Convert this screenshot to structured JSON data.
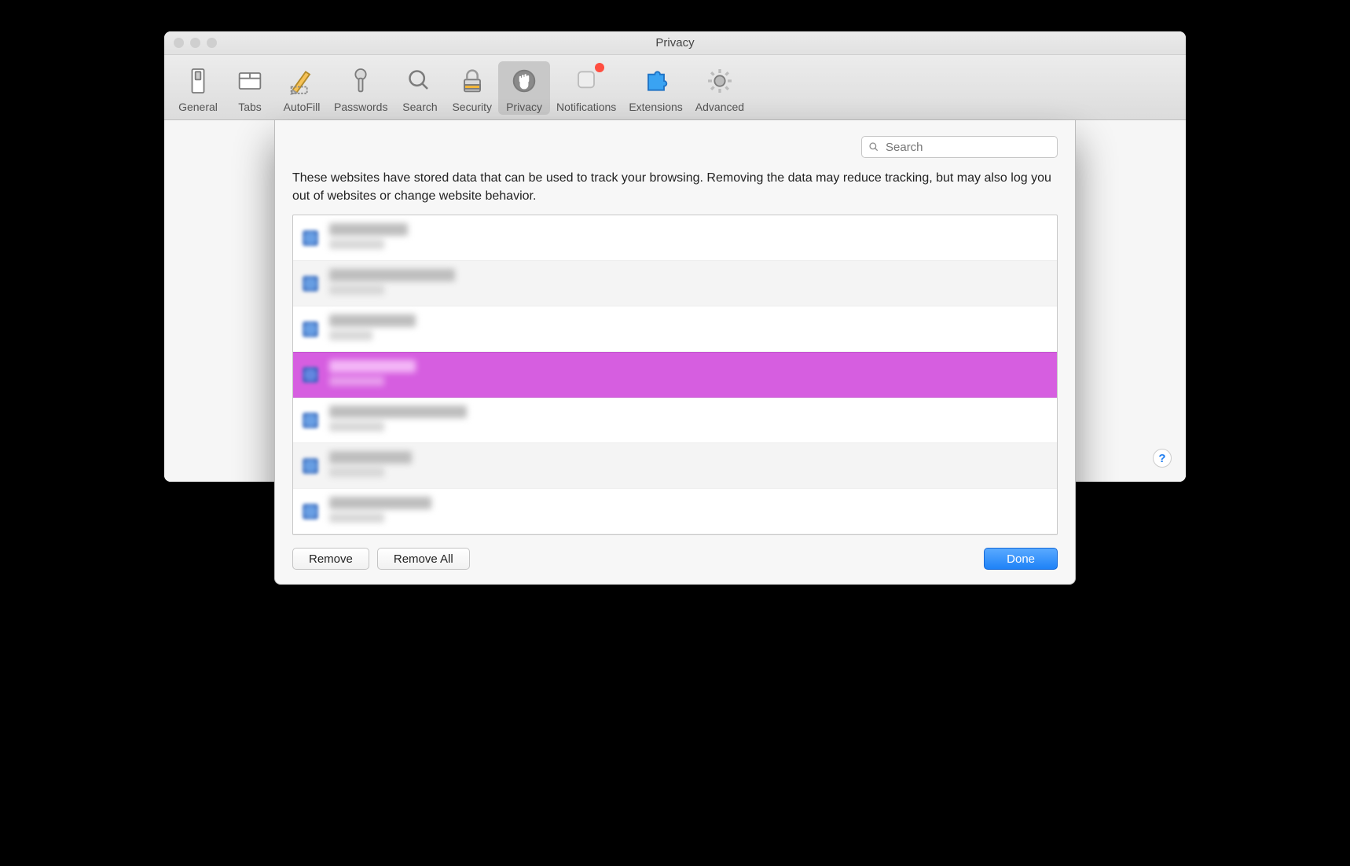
{
  "window": {
    "title": "Privacy"
  },
  "toolbar": {
    "items": [
      {
        "label": "General",
        "icon": "switch-icon",
        "active": false,
        "badge": false
      },
      {
        "label": "Tabs",
        "icon": "tabs-icon",
        "active": false,
        "badge": false
      },
      {
        "label": "AutoFill",
        "icon": "pencil-icon",
        "active": false,
        "badge": false
      },
      {
        "label": "Passwords",
        "icon": "key-icon",
        "active": false,
        "badge": false
      },
      {
        "label": "Search",
        "icon": "magnifier-icon",
        "active": false,
        "badge": false
      },
      {
        "label": "Security",
        "icon": "padlock-icon",
        "active": false,
        "badge": false
      },
      {
        "label": "Privacy",
        "icon": "hand-icon",
        "active": true,
        "badge": false
      },
      {
        "label": "Notifications",
        "icon": "square-icon",
        "active": false,
        "badge": true
      },
      {
        "label": "Extensions",
        "icon": "puzzle-icon",
        "active": false,
        "badge": false
      },
      {
        "label": "Advanced",
        "icon": "gear-icon",
        "active": false,
        "badge": false
      }
    ]
  },
  "help": {
    "glyph": "?"
  },
  "sheet": {
    "search": {
      "placeholder": "Search"
    },
    "description": "These websites have stored data that can be used to track your browsing. Removing the data may reduce tracking, but may also log you out of websites or change website behavior.",
    "rows": [
      {
        "domain": "████.com",
        "kind": "███████",
        "w1": 100,
        "w2": 70,
        "selected": false
      },
      {
        "domain": "██.██.███.███",
        "kind": "███████",
        "w1": 160,
        "w2": 70,
        "selected": false
      },
      {
        "domain": "████.███",
        "kind": "████",
        "w1": 110,
        "w2": 55,
        "selected": false
      },
      {
        "domain": "████.███",
        "kind": "███████",
        "w1": 110,
        "w2": 70,
        "selected": true
      },
      {
        "domain": "█████████.██.██",
        "kind": "███████",
        "w1": 175,
        "w2": 70,
        "selected": false
      },
      {
        "domain": "███.com",
        "kind": "███████",
        "w1": 105,
        "w2": 70,
        "selected": false
      },
      {
        "domain": "███.███.███",
        "kind": "███████",
        "w1": 130,
        "w2": 70,
        "selected": false
      }
    ],
    "buttons": {
      "remove": "Remove",
      "removeAll": "Remove All",
      "done": "Done"
    }
  }
}
